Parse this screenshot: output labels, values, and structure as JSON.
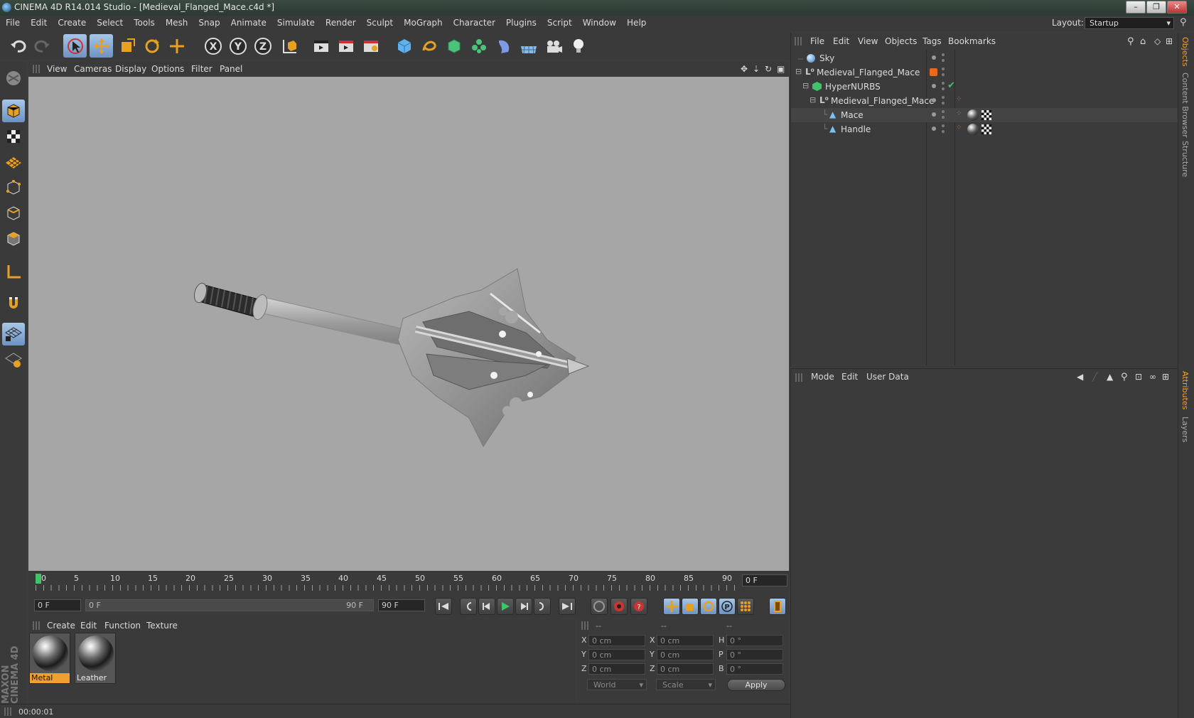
{
  "window": {
    "title": "CINEMA 4D R14.014 Studio - [Medieval_Flanged_Mace.c4d *]",
    "minimize": "–",
    "maximize": "❐",
    "close": "✕"
  },
  "menu": [
    "File",
    "Edit",
    "Create",
    "Select",
    "Tools",
    "Mesh",
    "Snap",
    "Animate",
    "Simulate",
    "Render",
    "Sculpt",
    "MoGraph",
    "Character",
    "Plugins",
    "Script",
    "Window",
    "Help"
  ],
  "layout": {
    "label": "Layout:",
    "value": "Startup"
  },
  "viewport": {
    "menu": [
      "View",
      "Cameras",
      "Display",
      "Options",
      "Filter",
      "Panel"
    ]
  },
  "timeline": {
    "ticks": [
      "0",
      "5",
      "10",
      "15",
      "20",
      "25",
      "30",
      "35",
      "40",
      "45",
      "50",
      "55",
      "60",
      "65",
      "70",
      "75",
      "80",
      "85",
      "90"
    ],
    "current_frame": "0 F"
  },
  "playback": {
    "start_field": "0 F",
    "range_start": "0 F",
    "range_end": "90 F",
    "end_field": "90 F"
  },
  "materials": {
    "menu": [
      "Create",
      "Edit",
      "Function",
      "Texture"
    ],
    "items": [
      {
        "name": "Metal",
        "selected": true
      },
      {
        "name": "Leather",
        "selected": false
      }
    ]
  },
  "coordinates": {
    "headers": [
      "--",
      "--",
      "--"
    ],
    "rows": [
      {
        "a_label": "X",
        "a_value": "0 cm",
        "b_label": "X",
        "b_value": "0 cm",
        "c_label": "H",
        "c_value": "0 °"
      },
      {
        "a_label": "Y",
        "a_value": "0 cm",
        "b_label": "Y",
        "b_value": "0 cm",
        "c_label": "P",
        "c_value": "0 °"
      },
      {
        "a_label": "Z",
        "a_value": "0 cm",
        "b_label": "Z",
        "b_value": "0 cm",
        "c_label": "B",
        "c_value": "0 °"
      }
    ],
    "space_dropdown": "World",
    "mode_dropdown": "Scale",
    "apply": "Apply"
  },
  "status": {
    "time": "00:00:01"
  },
  "objects": {
    "menu": [
      "File",
      "Edit",
      "View",
      "Objects",
      "Tags",
      "Bookmarks"
    ],
    "tree": [
      {
        "name": "Sky",
        "icon": "sky-icon"
      },
      {
        "name": "Medieval_Flanged_Mace",
        "icon": "null-icon"
      },
      {
        "name": "HyperNURBS",
        "icon": "hypernurbs-icon"
      },
      {
        "name": "Medieval_Flanged_Mace",
        "icon": "null-icon"
      },
      {
        "name": "Mace",
        "icon": "polygon-icon"
      },
      {
        "name": "Handle",
        "icon": "polygon-icon"
      }
    ]
  },
  "attributes": {
    "menu": [
      "Mode",
      "Edit",
      "User Data"
    ]
  },
  "side_tabs": {
    "top": [
      "Objects",
      "Content Browser",
      "Structure"
    ],
    "bottom": [
      "Attributes",
      "Layers"
    ]
  },
  "branding": "MAXON CINEMA 4D",
  "colors": {
    "accent": "#f0a030",
    "selection": "#8cb2dd",
    "viewport_bg": "#a6a6a6"
  }
}
